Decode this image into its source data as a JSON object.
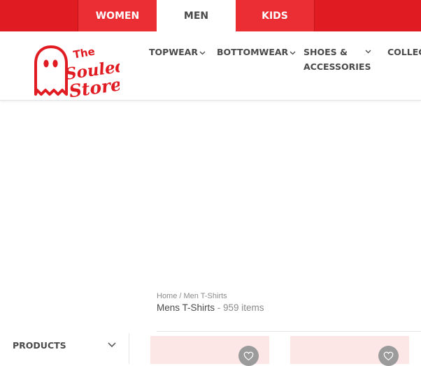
{
  "gender_tabs": [
    {
      "label": "WOMEN",
      "active": false
    },
    {
      "label": "MEN",
      "active": true
    },
    {
      "label": "KIDS",
      "active": false
    }
  ],
  "logo": {
    "line1": "The",
    "line2": "Souled",
    "line3": "Store"
  },
  "nav": {
    "topwear": "TOPWEAR",
    "bottomwear": "BOTTOMWEAR",
    "shoes_line1": "SHOES &",
    "shoes_line2": "ACCESSORIES",
    "collections": "COLLEC"
  },
  "breadcrumb": {
    "home": "Home",
    "separator": " / ",
    "current": "Men T-Shirts"
  },
  "listing": {
    "title": "Mens T-Shirts",
    "count": " - 959 items"
  },
  "filters": {
    "products_label": "PRODUCTS"
  },
  "icons": {
    "dropdown": "chevron-down-icon",
    "wishlist": "heart-icon"
  },
  "colors": {
    "brand_red": "#e11b22",
    "tab_red": "#ea2e33",
    "card_bg": "#fde6e6"
  }
}
